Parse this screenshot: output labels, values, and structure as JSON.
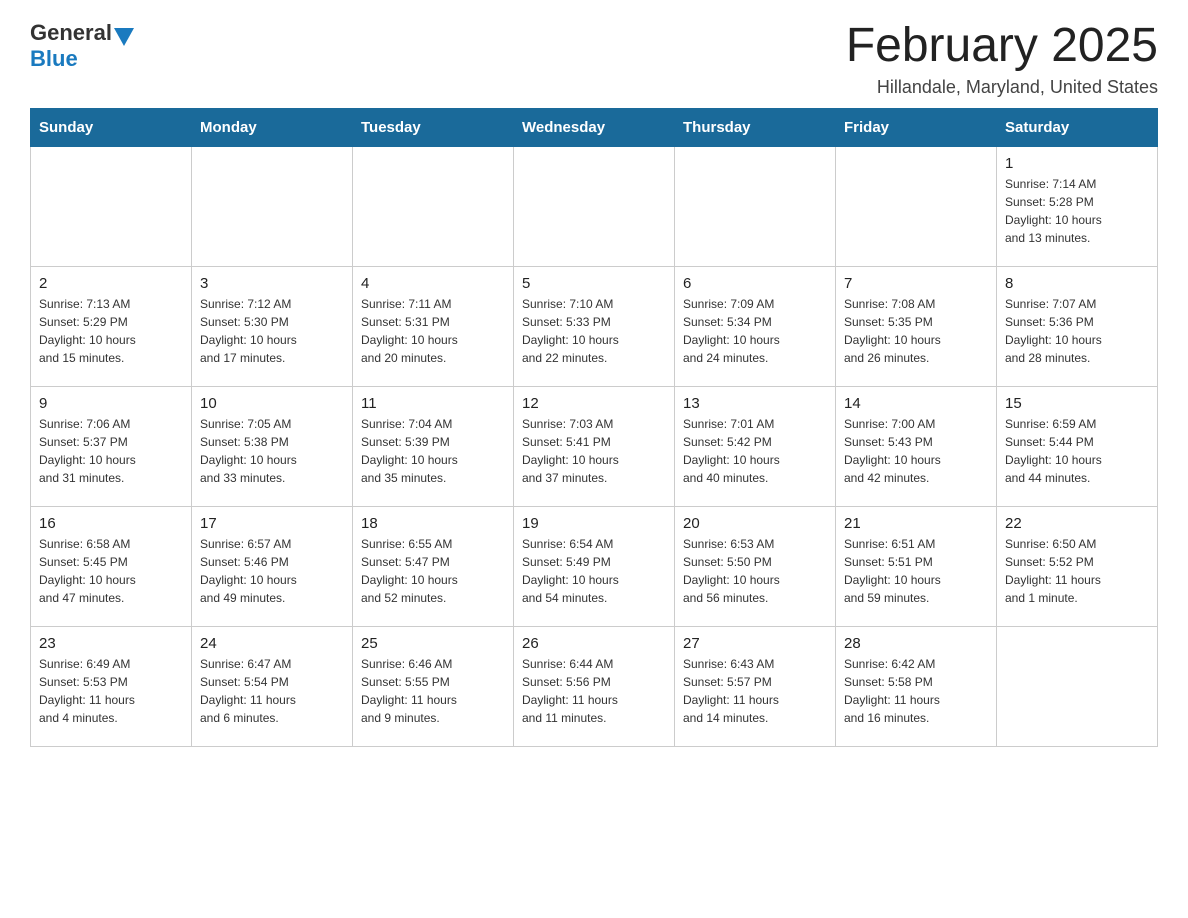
{
  "header": {
    "logo": {
      "general": "General",
      "blue": "Blue"
    },
    "title": "February 2025",
    "location": "Hillandale, Maryland, United States"
  },
  "weekdays": [
    "Sunday",
    "Monday",
    "Tuesday",
    "Wednesday",
    "Thursday",
    "Friday",
    "Saturday"
  ],
  "weeks": [
    [
      {
        "day": "",
        "info": ""
      },
      {
        "day": "",
        "info": ""
      },
      {
        "day": "",
        "info": ""
      },
      {
        "day": "",
        "info": ""
      },
      {
        "day": "",
        "info": ""
      },
      {
        "day": "",
        "info": ""
      },
      {
        "day": "1",
        "info": "Sunrise: 7:14 AM\nSunset: 5:28 PM\nDaylight: 10 hours\nand 13 minutes."
      }
    ],
    [
      {
        "day": "2",
        "info": "Sunrise: 7:13 AM\nSunset: 5:29 PM\nDaylight: 10 hours\nand 15 minutes."
      },
      {
        "day": "3",
        "info": "Sunrise: 7:12 AM\nSunset: 5:30 PM\nDaylight: 10 hours\nand 17 minutes."
      },
      {
        "day": "4",
        "info": "Sunrise: 7:11 AM\nSunset: 5:31 PM\nDaylight: 10 hours\nand 20 minutes."
      },
      {
        "day": "5",
        "info": "Sunrise: 7:10 AM\nSunset: 5:33 PM\nDaylight: 10 hours\nand 22 minutes."
      },
      {
        "day": "6",
        "info": "Sunrise: 7:09 AM\nSunset: 5:34 PM\nDaylight: 10 hours\nand 24 minutes."
      },
      {
        "day": "7",
        "info": "Sunrise: 7:08 AM\nSunset: 5:35 PM\nDaylight: 10 hours\nand 26 minutes."
      },
      {
        "day": "8",
        "info": "Sunrise: 7:07 AM\nSunset: 5:36 PM\nDaylight: 10 hours\nand 28 minutes."
      }
    ],
    [
      {
        "day": "9",
        "info": "Sunrise: 7:06 AM\nSunset: 5:37 PM\nDaylight: 10 hours\nand 31 minutes."
      },
      {
        "day": "10",
        "info": "Sunrise: 7:05 AM\nSunset: 5:38 PM\nDaylight: 10 hours\nand 33 minutes."
      },
      {
        "day": "11",
        "info": "Sunrise: 7:04 AM\nSunset: 5:39 PM\nDaylight: 10 hours\nand 35 minutes."
      },
      {
        "day": "12",
        "info": "Sunrise: 7:03 AM\nSunset: 5:41 PM\nDaylight: 10 hours\nand 37 minutes."
      },
      {
        "day": "13",
        "info": "Sunrise: 7:01 AM\nSunset: 5:42 PM\nDaylight: 10 hours\nand 40 minutes."
      },
      {
        "day": "14",
        "info": "Sunrise: 7:00 AM\nSunset: 5:43 PM\nDaylight: 10 hours\nand 42 minutes."
      },
      {
        "day": "15",
        "info": "Sunrise: 6:59 AM\nSunset: 5:44 PM\nDaylight: 10 hours\nand 44 minutes."
      }
    ],
    [
      {
        "day": "16",
        "info": "Sunrise: 6:58 AM\nSunset: 5:45 PM\nDaylight: 10 hours\nand 47 minutes."
      },
      {
        "day": "17",
        "info": "Sunrise: 6:57 AM\nSunset: 5:46 PM\nDaylight: 10 hours\nand 49 minutes."
      },
      {
        "day": "18",
        "info": "Sunrise: 6:55 AM\nSunset: 5:47 PM\nDaylight: 10 hours\nand 52 minutes."
      },
      {
        "day": "19",
        "info": "Sunrise: 6:54 AM\nSunset: 5:49 PM\nDaylight: 10 hours\nand 54 minutes."
      },
      {
        "day": "20",
        "info": "Sunrise: 6:53 AM\nSunset: 5:50 PM\nDaylight: 10 hours\nand 56 minutes."
      },
      {
        "day": "21",
        "info": "Sunrise: 6:51 AM\nSunset: 5:51 PM\nDaylight: 10 hours\nand 59 minutes."
      },
      {
        "day": "22",
        "info": "Sunrise: 6:50 AM\nSunset: 5:52 PM\nDaylight: 11 hours\nand 1 minute."
      }
    ],
    [
      {
        "day": "23",
        "info": "Sunrise: 6:49 AM\nSunset: 5:53 PM\nDaylight: 11 hours\nand 4 minutes."
      },
      {
        "day": "24",
        "info": "Sunrise: 6:47 AM\nSunset: 5:54 PM\nDaylight: 11 hours\nand 6 minutes."
      },
      {
        "day": "25",
        "info": "Sunrise: 6:46 AM\nSunset: 5:55 PM\nDaylight: 11 hours\nand 9 minutes."
      },
      {
        "day": "26",
        "info": "Sunrise: 6:44 AM\nSunset: 5:56 PM\nDaylight: 11 hours\nand 11 minutes."
      },
      {
        "day": "27",
        "info": "Sunrise: 6:43 AM\nSunset: 5:57 PM\nDaylight: 11 hours\nand 14 minutes."
      },
      {
        "day": "28",
        "info": "Sunrise: 6:42 AM\nSunset: 5:58 PM\nDaylight: 11 hours\nand 16 minutes."
      },
      {
        "day": "",
        "info": ""
      }
    ]
  ]
}
